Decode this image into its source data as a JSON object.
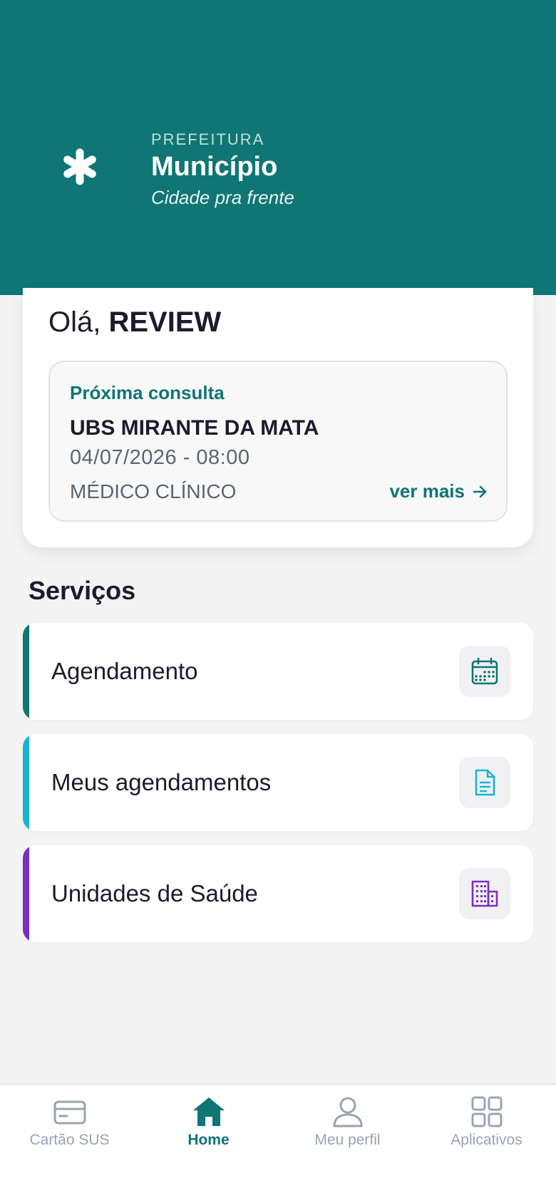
{
  "header": {
    "kicker": "PREFEITURA",
    "title": "Município",
    "slogan": "Cidade pra frente",
    "background_color": "#0f7575",
    "logo_icon": "asterisk-icon"
  },
  "greeting": {
    "hello": "Olá,",
    "name": "REVIEW"
  },
  "next_appointment": {
    "kicker": "Próxima consulta",
    "unit": "UBS MIRANTE DA MATA",
    "datetime": "04/07/2026 - 08:00",
    "specialty": "MÉDICO CLÍNICO",
    "more_label": "ver mais",
    "more_icon": "arrow-right-icon"
  },
  "services": {
    "title": "Serviços",
    "items": [
      {
        "label": "Agendamento",
        "icon": "calendar-icon",
        "color": "#0f7575"
      },
      {
        "label": "Meus agendamentos",
        "icon": "document-icon",
        "color": "#19b4d2"
      },
      {
        "label": "Unidades de Saúde",
        "icon": "building-icon",
        "color": "#7b2fbe"
      }
    ]
  },
  "tabbar": {
    "active": "Home",
    "items": [
      {
        "label": "Cartão SUS",
        "icon": "card-icon"
      },
      {
        "label": "Home",
        "icon": "home-icon"
      },
      {
        "label": "Meu perfil",
        "icon": "user-icon"
      },
      {
        "label": "Aplicativos",
        "icon": "grid-icon"
      }
    ]
  }
}
